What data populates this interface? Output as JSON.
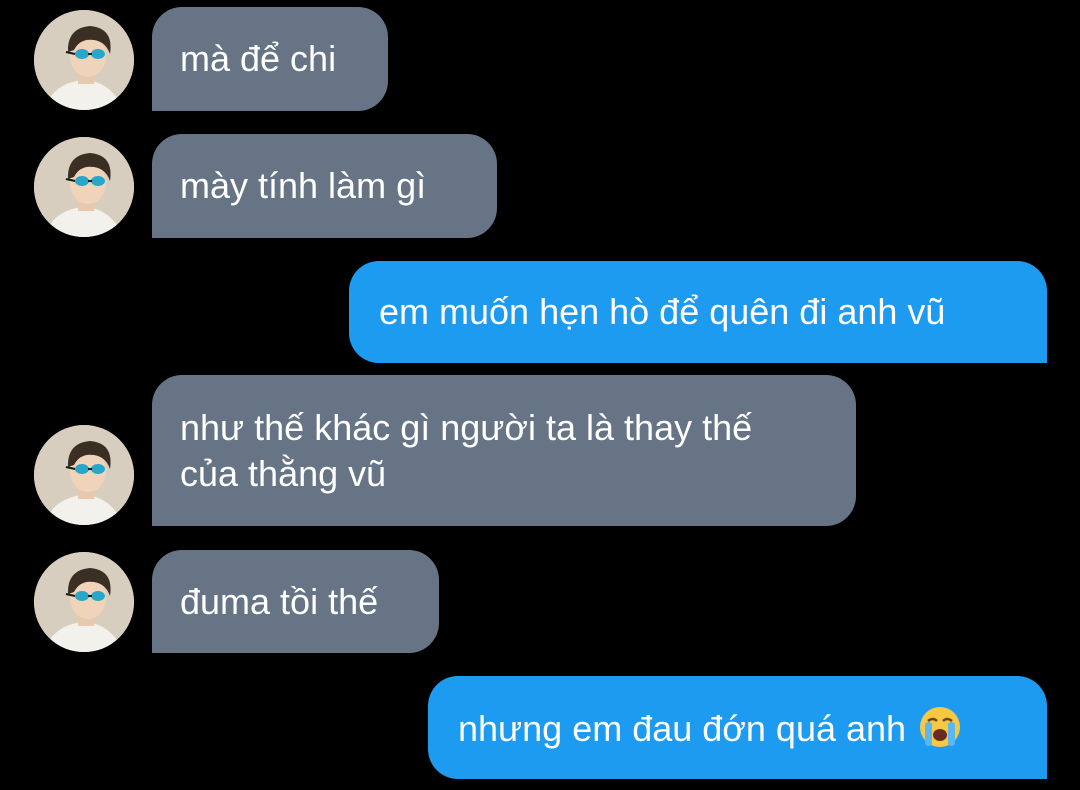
{
  "colors": {
    "background": "#000000",
    "received_bubble": "#667485",
    "sent_bubble": "#1d9bf0",
    "text": "#ffffff"
  },
  "messages": [
    {
      "direction": "received",
      "text": "mà để chi"
    },
    {
      "direction": "received",
      "text": "mày tính làm gì"
    },
    {
      "direction": "sent",
      "text": "em muốn hẹn hò để quên đi anh vũ"
    },
    {
      "direction": "received",
      "lines": [
        "như thế khác gì người ta là thay thế",
        "của thằng vũ"
      ]
    },
    {
      "direction": "received",
      "text": "đuma tồi thế"
    },
    {
      "direction": "sent",
      "text": "nhưng em đau đớn quá anh",
      "emoji": "loudly-crying-face-emoji"
    }
  ]
}
